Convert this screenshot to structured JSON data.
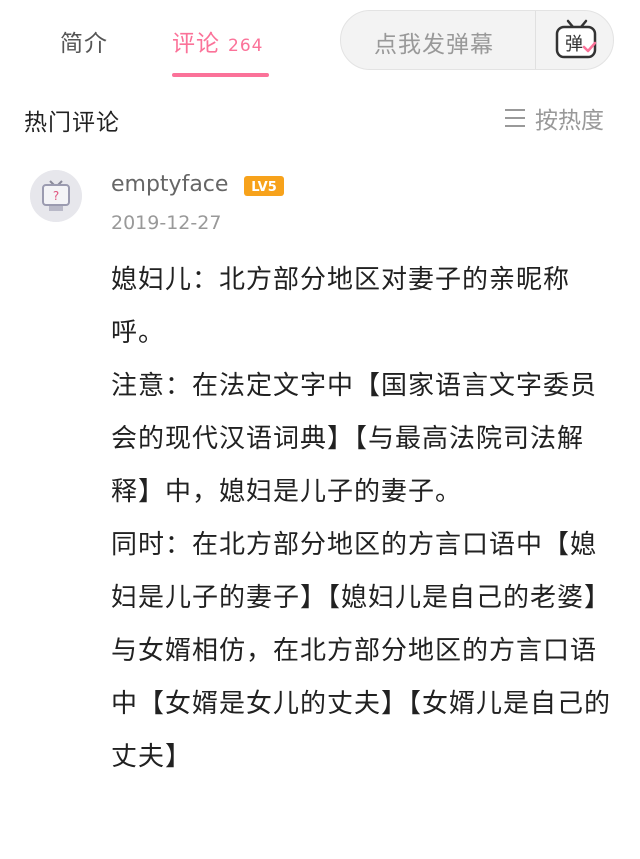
{
  "tabs": {
    "intro_label": "简介",
    "comments_label": "评论",
    "comments_count": "264"
  },
  "danmaku": {
    "placeholder": "点我发弹幕",
    "icon_char": "弹",
    "icon": "danmaku-tv-icon"
  },
  "section": {
    "title": "热门评论",
    "sort_label": "按热度",
    "sort_icon": "menu-lines-icon"
  },
  "comment": {
    "username": "emptyface",
    "level": "LV5",
    "date": "2019-12-27",
    "avatar_icon": "tv-question-avatar",
    "text": "媳妇儿：北方部分地区对妻子的亲昵称呼。\n注意：在法定文字中【国家语言文字委员会的现代汉语词典】【与最高法院司法解释】中，媳妇是儿子的妻子。\n同时：在北方部分地区的方言口语中【媳妇是儿子的妻子】【媳妇儿是自己的老婆】\n与女婿相仿，在北方部分地区的方言口语中【女婿是女儿的丈夫】【女婿儿是自己的丈夫】"
  },
  "colors": {
    "accent": "#fb7299",
    "level_badge": "#f7a21b",
    "muted_text": "#999999"
  }
}
